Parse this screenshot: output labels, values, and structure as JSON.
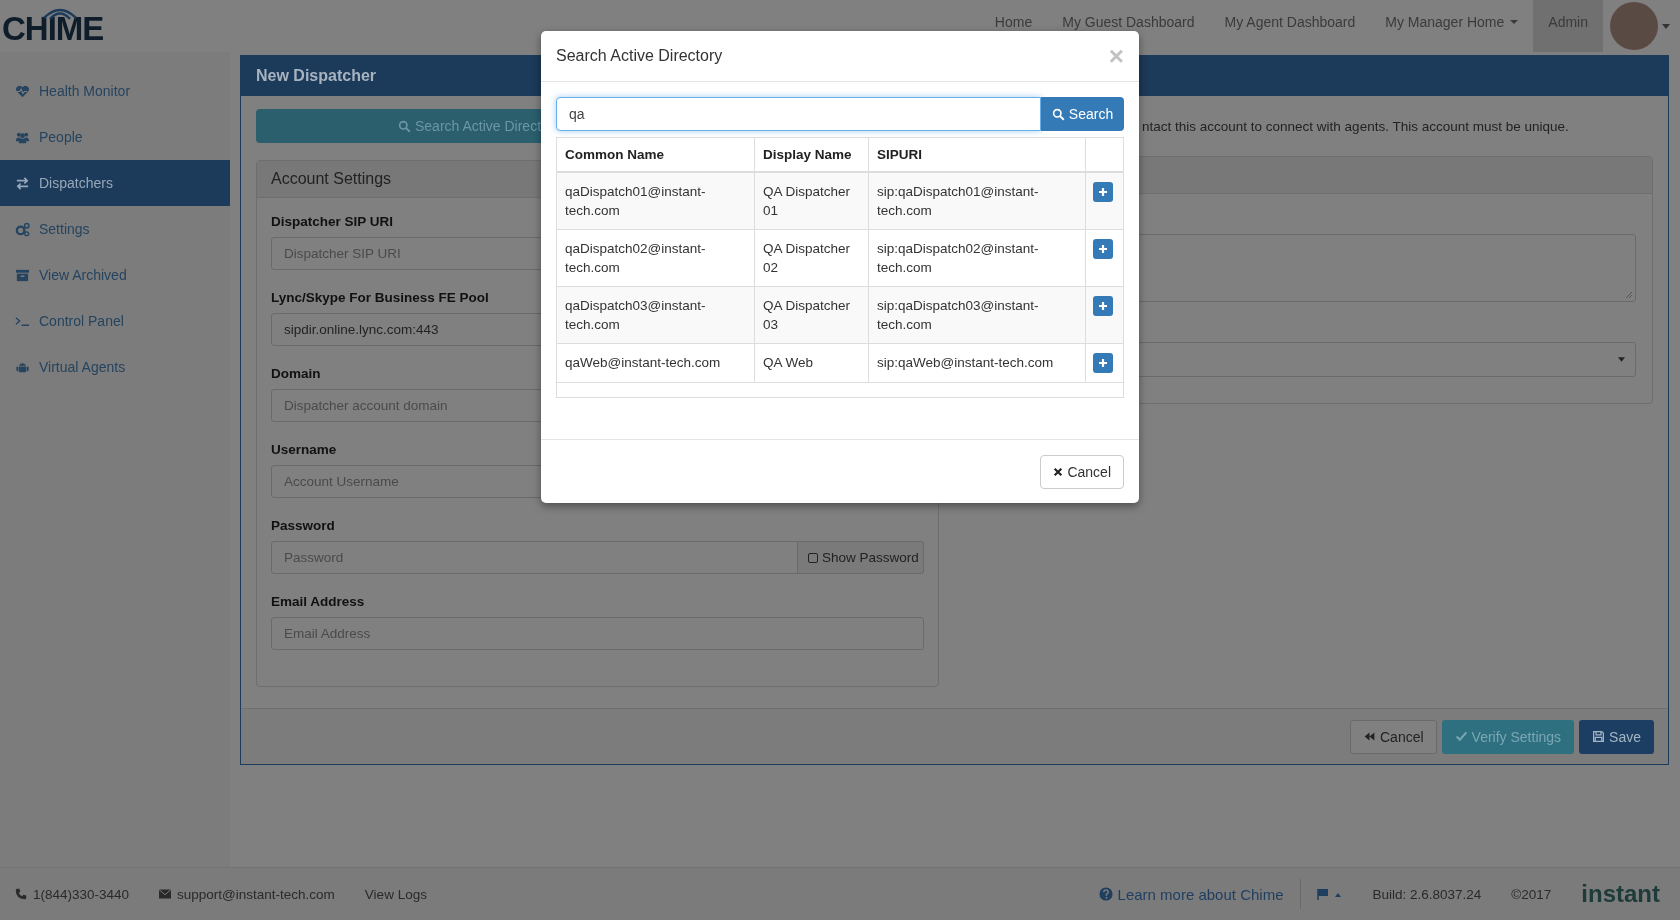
{
  "header": {
    "logo": "CHIME",
    "nav": [
      {
        "label": "Home",
        "dropdown": false,
        "selected": false
      },
      {
        "label": "My Guest Dashboard",
        "dropdown": false,
        "selected": false
      },
      {
        "label": "My Agent Dashboard",
        "dropdown": false,
        "selected": false
      },
      {
        "label": "My Manager Home",
        "dropdown": true,
        "selected": false
      },
      {
        "label": "Admin",
        "dropdown": false,
        "selected": true
      }
    ]
  },
  "sidebar": {
    "items": [
      {
        "label": "Health Monitor",
        "selected": false
      },
      {
        "label": "People",
        "selected": false
      },
      {
        "label": "Dispatchers",
        "selected": true
      },
      {
        "label": "Settings",
        "selected": false
      },
      {
        "label": "View Archived",
        "selected": false
      },
      {
        "label": "Control Panel",
        "selected": false
      },
      {
        "label": "Virtual Agents",
        "selected": false
      }
    ]
  },
  "panel": {
    "title": "New Dispatcher",
    "search_button": "Search Active Direct",
    "account_settings": {
      "title": "Account Settings",
      "fields": [
        {
          "kind": "text",
          "label": "Dispatcher SIP URI",
          "placeholder": "Dispatcher SIP URI"
        },
        {
          "kind": "text",
          "label": "Lync/Skype For Business FE Pool",
          "value": "sipdir.online.lync.com:443"
        },
        {
          "kind": "text",
          "label": "Domain",
          "placeholder": "Dispatcher account domain"
        },
        {
          "kind": "text",
          "label": "Username",
          "placeholder": "Account Username"
        },
        {
          "kind": "password",
          "label": "Password",
          "placeholder": "Password",
          "toggle": {
            "label": "Show Password",
            "checked": false
          }
        },
        {
          "kind": "text",
          "label": "Email Address",
          "placeholder": "Email Address"
        }
      ]
    },
    "note": "ntact this account to connect with agents. This account must be unique.",
    "actions": [
      {
        "label": "Cancel",
        "kind": "default"
      },
      {
        "label": "Verify Settings",
        "kind": "info"
      },
      {
        "label": "Save",
        "kind": "primary"
      }
    ]
  },
  "modal": {
    "title": "Search Active Directory",
    "close": "×",
    "search": {
      "value": "qa",
      "button": "Search"
    },
    "table": {
      "columns": [
        "Common Name",
        "Display Name",
        "SIPURI"
      ],
      "rows": [
        {
          "common_name": "qaDispatch01@instant-tech.com",
          "display_name": "QA Dispatcher 01",
          "sipuri": "sip:qaDispatch01@instant-tech.com"
        },
        {
          "common_name": "qaDispatch02@instant-tech.com",
          "display_name": "QA Dispatcher 02",
          "sipuri": "sip:qaDispatch02@instant-tech.com"
        },
        {
          "common_name": "qaDispatch03@instant-tech.com",
          "display_name": "QA Dispatcher 03",
          "sipuri": "sip:qaDispatch03@instant-tech.com"
        },
        {
          "common_name": "qaWeb@instant-tech.com",
          "display_name": "QA Web",
          "sipuri": "sip:qaWeb@instant-tech.com"
        }
      ]
    },
    "cancel": "Cancel"
  },
  "footer": {
    "phone": "1(844)330-3440",
    "email": "support@instant-tech.com",
    "logs": "View Logs",
    "learn_more": "Learn more about Chime",
    "build": "Build: 2.6.8037.24",
    "copyright": "©2017",
    "logo": "instant"
  }
}
